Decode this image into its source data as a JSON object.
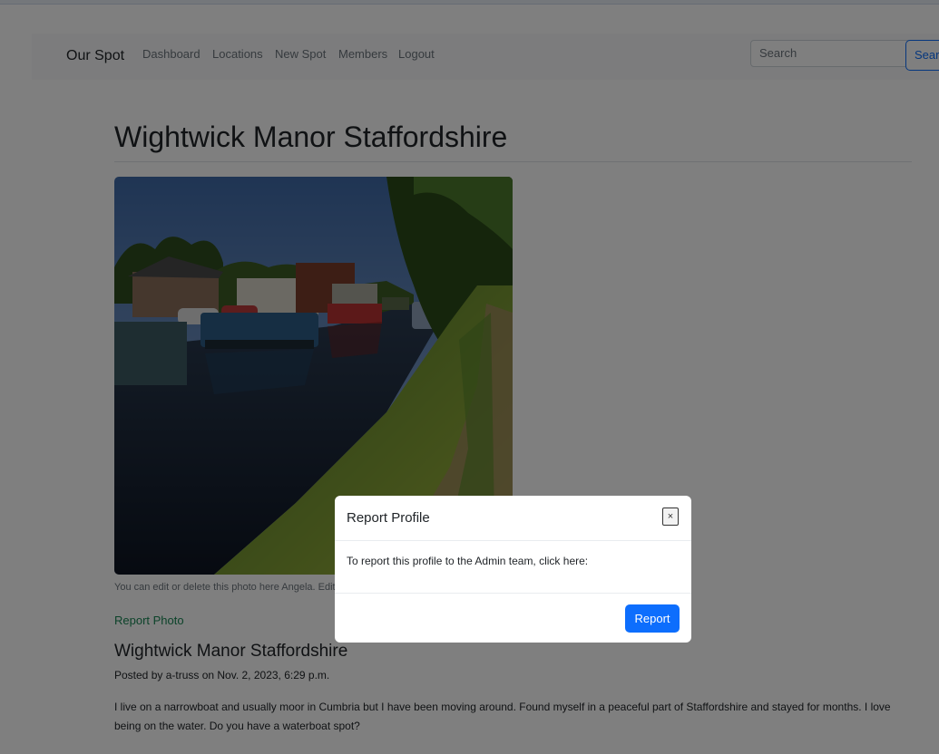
{
  "nav": {
    "brand": "Our Spot",
    "links": [
      "Dashboard",
      "Locations",
      "New Spot",
      "Members",
      "Logout"
    ],
    "search_placeholder": "Search",
    "search_button": "Search"
  },
  "spot": {
    "title": "Wightwick Manor Staffordshire",
    "photo_note": "You can edit or delete this photo here Angela. Edit",
    "report_photo": "Report Photo",
    "post_title": "Wightwick Manor Staffordshire",
    "posted_by": "Posted by a-truss on Nov. 2, 2023, 6:29 p.m.",
    "body": "I live on a narrowboat and usually moor in Cumbria but I have been moving around. Found myself in a peaceful part of Staffordshire and stayed for months. I love being on the water. Do you have a waterboat spot?"
  },
  "modal": {
    "title": "Report Profile",
    "close": "×",
    "body": "To report this profile to the Admin team, click here:",
    "button": "Report"
  },
  "colors": {
    "primary": "#0d6efd",
    "success_link": "#198754",
    "backdrop": "rgba(0,0,0,0.5)"
  }
}
